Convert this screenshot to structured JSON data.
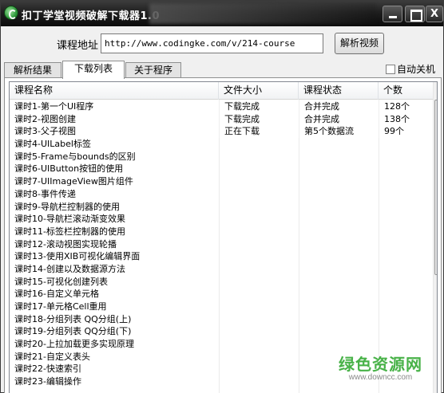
{
  "window": {
    "title": "扣丁学堂视频破解下载器1.0",
    "min_label": "",
    "max_label": "",
    "close_label": "X"
  },
  "url_row": {
    "label": "课程地址",
    "value": "http://www.codingke.com/v/214-course",
    "parse_button": "解析视频"
  },
  "tabs": [
    {
      "label": "解析结果",
      "active": false
    },
    {
      "label": "下载列表",
      "active": true
    },
    {
      "label": "关于程序",
      "active": false
    }
  ],
  "auto_shutdown": {
    "label": "自动关机",
    "checked": false
  },
  "table": {
    "headers": [
      "课程名称",
      "文件大小",
      "课程状态",
      "个数"
    ],
    "rows": [
      {
        "name": "课时1-第一个UI程序",
        "size": "下载完成",
        "status": "合并完成",
        "count": "128个"
      },
      {
        "name": "课时2-视图创建",
        "size": "下载完成",
        "status": "合并完成",
        "count": "138个"
      },
      {
        "name": "课时3-父子视图",
        "size": "正在下载",
        "status": "第5个数据流",
        "count": "99个"
      },
      {
        "name": "课时4-UILabel标签",
        "size": "",
        "status": "",
        "count": ""
      },
      {
        "name": "课时5-Frame与bounds的区别",
        "size": "",
        "status": "",
        "count": ""
      },
      {
        "name": "课时6-UIButton按钮的使用",
        "size": "",
        "status": "",
        "count": ""
      },
      {
        "name": "课时7-UIImageView图片组件",
        "size": "",
        "status": "",
        "count": ""
      },
      {
        "name": "课时8-事件传递",
        "size": "",
        "status": "",
        "count": ""
      },
      {
        "name": "课时9-导航栏控制器的使用",
        "size": "",
        "status": "",
        "count": ""
      },
      {
        "name": "课时10-导航栏滚动渐变效果",
        "size": "",
        "status": "",
        "count": ""
      },
      {
        "name": "课时11-标签栏控制器的使用",
        "size": "",
        "status": "",
        "count": ""
      },
      {
        "name": "课时12-滚动视图实现轮播",
        "size": "",
        "status": "",
        "count": ""
      },
      {
        "name": "课时13-使用XIB可视化编辑界面",
        "size": "",
        "status": "",
        "count": ""
      },
      {
        "name": "课时14-创建以及数据源方法",
        "size": "",
        "status": "",
        "count": ""
      },
      {
        "name": "课时15-可视化创建列表",
        "size": "",
        "status": "",
        "count": ""
      },
      {
        "name": "课时16-自定义单元格",
        "size": "",
        "status": "",
        "count": ""
      },
      {
        "name": "课时17-单元格Cell重用",
        "size": "",
        "status": "",
        "count": ""
      },
      {
        "name": "课时18-分组列表 QQ分组(上)",
        "size": "",
        "status": "",
        "count": ""
      },
      {
        "name": "课时19-分组列表 QQ分组(下)",
        "size": "",
        "status": "",
        "count": ""
      },
      {
        "name": "课时20-上拉加载更多实现原理",
        "size": "",
        "status": "",
        "count": ""
      },
      {
        "name": "课时21-自定义表头",
        "size": "",
        "status": "",
        "count": ""
      },
      {
        "name": "课时22-快速索引",
        "size": "",
        "status": "",
        "count": ""
      },
      {
        "name": "课时23-编辑操作",
        "size": "",
        "status": "",
        "count": ""
      }
    ]
  },
  "watermark": {
    "text": "绿色资源网",
    "url": "www.downcc.com"
  },
  "colors": {
    "titlebar": "#1f1f1f",
    "watermark_green": "#3fae3f"
  }
}
